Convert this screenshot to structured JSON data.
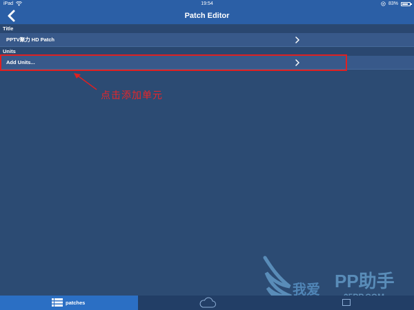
{
  "status_bar": {
    "device": "iPad",
    "time": "19:54",
    "battery_percent": "83%",
    "battery_level": 0.83,
    "icons": [
      "wifi-icon",
      "location-icon",
      "battery-icon"
    ]
  },
  "nav": {
    "title": "Patch Editor",
    "back_icon": "chevron-left-icon"
  },
  "sections": {
    "title_header": "Title",
    "title_value": "PPTV聚力 HD Patch",
    "units_header": "Units",
    "add_units_label": "Add Units..."
  },
  "annotation": {
    "text": "点击添加单元",
    "color": "#e8262a"
  },
  "tabbar": {
    "patches_label": "patches",
    "icons": [
      "list-icon",
      "cloud-icon",
      "document-icon"
    ]
  },
  "watermark": {
    "brand": "PP助手",
    "cn_text": "我爱",
    "url": "25PP.COM"
  },
  "colors": {
    "nav_bg": "#2b5fa6",
    "content_bg": "#2c4b73",
    "row_bg": "#38598a",
    "tab_active": "#2b6fc4",
    "highlight_red": "#e02020"
  }
}
